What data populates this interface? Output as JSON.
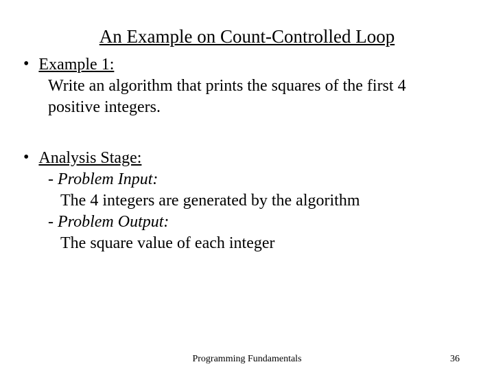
{
  "title": "An Example on Count-Controlled Loop",
  "section1": {
    "heading": "Example 1:",
    "body": "Write an algorithm that prints the squares of the first 4 positive integers."
  },
  "section2": {
    "heading": "Analysis Stage:",
    "item1": {
      "label": "- Problem Input:",
      "text": "The 4 integers are generated by the algorithm"
    },
    "item2": {
      "label": "- Problem Output:",
      "text": "The square value of each integer"
    }
  },
  "footer": {
    "center": "Programming Fundamentals",
    "page": "36"
  },
  "bullet": "•"
}
